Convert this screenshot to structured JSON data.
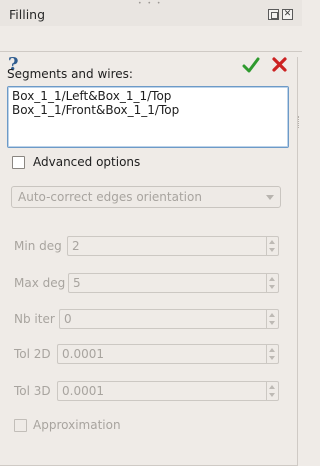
{
  "window": {
    "title": "Filling",
    "float_icon": "float-icon",
    "close_icon": "close-x-icon"
  },
  "toolbar": {
    "help_icon": "help-question-icon",
    "help_glyph": "?",
    "ok_icon": "green-check-icon",
    "cancel_icon": "red-x-icon"
  },
  "segments": {
    "label": "Segments and wires:",
    "items": [
      "Box_1_1/Left&Box_1_1/Top",
      "Box_1_1/Front&Box_1_1/Top"
    ]
  },
  "advanced": {
    "label": "Advanced options",
    "checked": false
  },
  "orientation": {
    "value": "Auto-correct edges orientation",
    "enabled": false
  },
  "params": {
    "min_deg": {
      "label": "Min deg",
      "value": "2"
    },
    "max_deg": {
      "label": "Max deg",
      "value": "5"
    },
    "nb_iter": {
      "label": "Nb iter",
      "value": "0"
    },
    "tol_2d": {
      "label": "Tol 2D",
      "value": "0.0001"
    },
    "tol_3d": {
      "label": "Tol 3D",
      "value": "0.0001"
    }
  },
  "approximation": {
    "label": "Approximation",
    "checked": false,
    "enabled": false
  }
}
